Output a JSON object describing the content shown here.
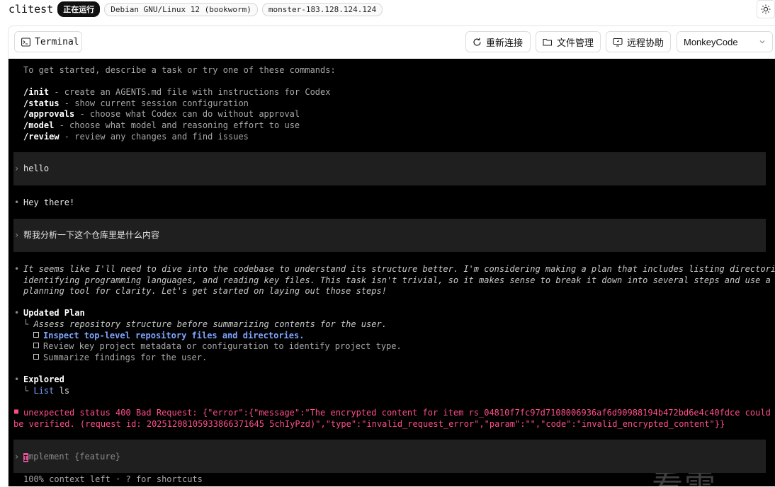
{
  "header": {
    "app_name": "clitest",
    "status": "正在运行",
    "os": "Debian GNU/Linux 12 (bookworm)",
    "host": "monster-183.128.124.124"
  },
  "toolbar": {
    "terminal_tab": "Terminal",
    "reconnect": "重新连接",
    "file_manager": "文件管理",
    "remote_assist": "远程协助",
    "selected_tool": "MonkeyCode"
  },
  "terminal": {
    "intro": "To get started, describe a task or try one of these commands:",
    "commands": [
      {
        "cmd": "/init",
        "desc": " - create an AGENTS.md file with instructions for Codex"
      },
      {
        "cmd": "/status",
        "desc": " - show current session configuration"
      },
      {
        "cmd": "/approvals",
        "desc": " - choose what Codex can do without approval"
      },
      {
        "cmd": "/model",
        "desc": " - choose what model and reasoning effort to use"
      },
      {
        "cmd": "/review",
        "desc": " - review any changes and find issues"
      }
    ],
    "user_msg_1": "hello",
    "reply_1": "Hey there!",
    "user_msg_2": "帮我分析一下这个仓库里是什么内容",
    "thinking_1": "It seems like I'll need to dive into the codebase to understand its structure better. I'm considering making a plan that includes listing directories,",
    "thinking_2": "identifying programming languages, and reading key files. This task isn't trivial, so it makes sense to break it down into several steps and use a",
    "thinking_3": "planning tool for clarity. Let's get started on laying out those steps!",
    "plan_title": "Updated Plan",
    "plan_note": "Assess repository structure before summarizing contents for the user.",
    "plan_items": [
      "Inspect top-level repository files and directories.",
      "Review key project metadata or configuration to identify project type.",
      "Summarize findings for the user."
    ],
    "explored_title": "Explored",
    "explored_cmd": "List",
    "explored_arg": "ls",
    "error_1": "unexpected status 400 Bad Request: {\"error\":{\"message\":\"The encrypted content for item rs_04810f7fc97d7108006936af6d90988194b472bd6e4c40fdce could not",
    "error_2": "be verified. (request id: 20251208105933866371645 5chIyPzd)\",\"type\":\"invalid_request_error\",\"param\":\"\",\"code\":\"invalid_encrypted_content\"}}",
    "input_placeholder": "mplement {feature}",
    "input_first_char": "I",
    "footer": "100% context left · ? for shortcuts",
    "watermark": "看雪"
  },
  "colors": {
    "error": "#ff4d8b",
    "highlight": "#7ea6ff",
    "cursor": "#e0559a"
  }
}
